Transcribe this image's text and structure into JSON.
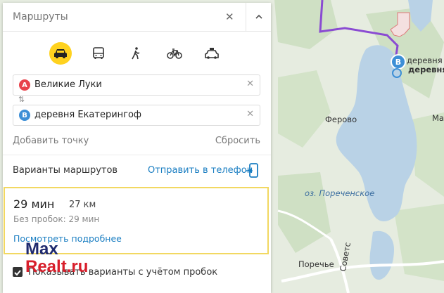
{
  "panel": {
    "title": "Маршруты",
    "modes": [
      {
        "icon": "car-icon",
        "active": true
      },
      {
        "icon": "bus-icon",
        "active": false
      },
      {
        "icon": "walking-person-icon",
        "active": false
      },
      {
        "icon": "bicycle-icon",
        "active": false
      },
      {
        "icon": "taxi-icon",
        "active": false
      }
    ],
    "point_a": {
      "pin": "A",
      "value": "Великие Луки"
    },
    "point_b": {
      "pin": "B",
      "value": "деревня Екатерингоф"
    },
    "swap_glyph": "⇅",
    "add_point": "Добавить точку",
    "reset": "Сбросить",
    "variants_label": "Варианты маршрутов",
    "send_to_phone": "Отправить в телефон",
    "route": {
      "time": "29 мин",
      "distance": "27 км",
      "no_traffic": "Без пробок: 29 мин",
      "details_link": "Посмотреть подробнее"
    },
    "traffic_checkbox": {
      "label": "Показывать варианты с учётом пробок",
      "checked": true
    }
  },
  "map": {
    "labels": {
      "ferovo": "Ферово",
      "lake": "оз. Пореченское",
      "porechye": "Поречье",
      "sovetskaya": "Советс",
      "dest_line1": "деревня",
      "dest_line2": "деревня",
      "edge": "Ма"
    },
    "pin_b": "B",
    "colors": {
      "route": "#8a4bd2",
      "water": "#b9d2e6",
      "land": "#e6ece0",
      "forest": "#cfe0c4",
      "pin_b": "#3d8fd6"
    }
  },
  "watermark": {
    "line1": "Max",
    "line2": "Realt.ru"
  }
}
